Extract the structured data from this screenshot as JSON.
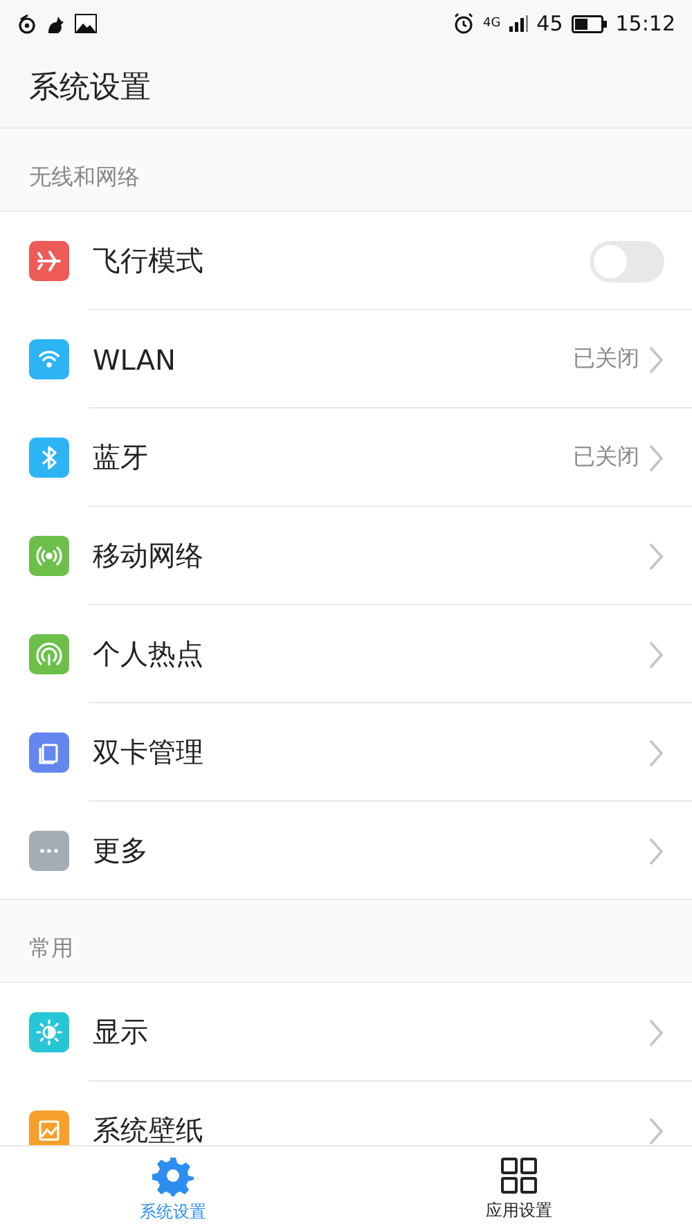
{
  "status_bar": {
    "network": "4G",
    "battery": "45",
    "time": "15:12"
  },
  "header": {
    "title": "系统设置"
  },
  "sections": [
    {
      "title": "无线和网络",
      "items": [
        {
          "label": "飞行模式",
          "kind": "toggle",
          "on": false,
          "color": "#ee5a55"
        },
        {
          "label": "WLAN",
          "kind": "link",
          "value": "已关闭",
          "color": "#2db4f5"
        },
        {
          "label": "蓝牙",
          "kind": "link",
          "value": "已关闭",
          "color": "#2db4f5"
        },
        {
          "label": "移动网络",
          "kind": "link",
          "color": "#6cc04a"
        },
        {
          "label": "个人热点",
          "kind": "link",
          "color": "#6cc04a"
        },
        {
          "label": "双卡管理",
          "kind": "link",
          "color": "#6486f0"
        },
        {
          "label": "更多",
          "kind": "link",
          "color": "#a4acb4"
        }
      ]
    },
    {
      "title": "常用",
      "items": [
        {
          "label": "显示",
          "kind": "link",
          "color": "#26c6d6"
        },
        {
          "label": "系统壁纸",
          "kind": "link",
          "color": "#f5a02a"
        }
      ]
    }
  ],
  "bottom_nav": [
    {
      "label": "系统设置",
      "selected": true
    },
    {
      "label": "应用设置",
      "selected": false
    }
  ]
}
